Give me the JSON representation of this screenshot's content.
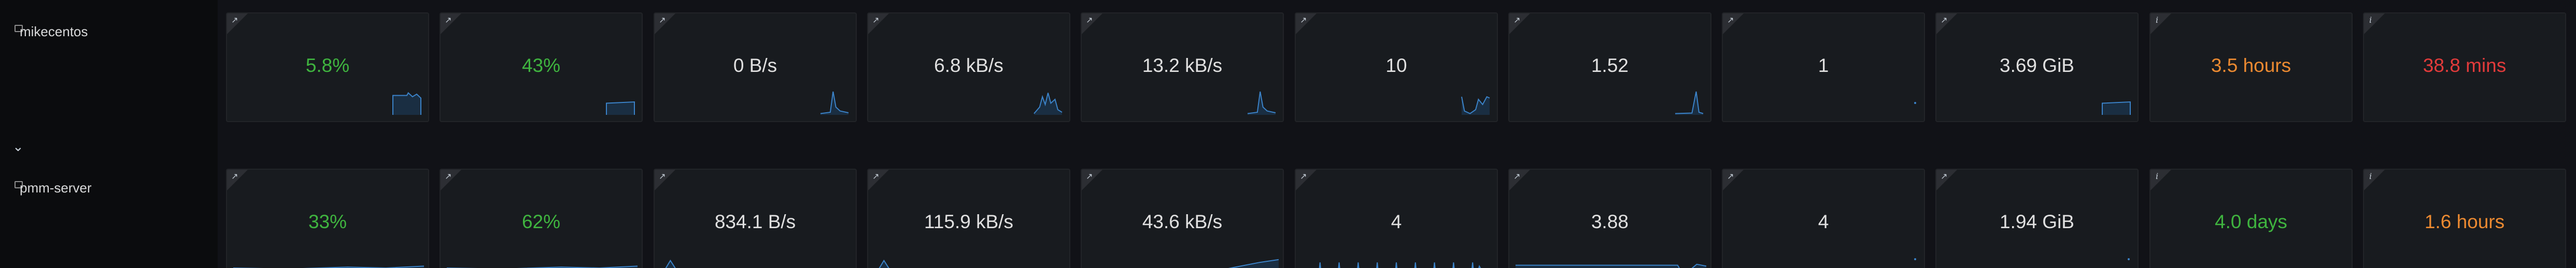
{
  "colors": {
    "green": "#3fb43f",
    "orange": "#ec8a31",
    "red": "#e23b3b",
    "neutral": "#e0e0e0",
    "spark_line": "#3b83c9",
    "spark_fill": "#1d3c5a"
  },
  "hosts": [
    {
      "name": "mikecentos",
      "stats": [
        {
          "value": "5.8%",
          "color": "green",
          "icon": "external-link-icon",
          "spark": "step-end"
        },
        {
          "value": "43%",
          "color": "green",
          "icon": "external-link-icon",
          "spark": "flat-end"
        },
        {
          "value": "0 B/s",
          "color": "neutral",
          "icon": "external-link-icon",
          "spark": "peak-end"
        },
        {
          "value": "6.8 kB/s",
          "color": "neutral",
          "icon": "external-link-icon",
          "spark": "multi-peak-end"
        },
        {
          "value": "13.2 kB/s",
          "color": "neutral",
          "icon": "external-link-icon",
          "spark": "peak-end"
        },
        {
          "value": "10",
          "color": "neutral",
          "icon": "external-link-icon",
          "spark": "wave-end"
        },
        {
          "value": "1.52",
          "color": "neutral",
          "icon": "external-link-icon",
          "spark": "spike-end"
        },
        {
          "value": "1",
          "color": "neutral",
          "icon": "external-link-icon",
          "spark": "dot"
        },
        {
          "value": "3.69 GiB",
          "color": "neutral",
          "icon": "external-link-icon",
          "spark": "flat-end"
        },
        {
          "value": "3.5 hours",
          "color": "orange",
          "icon": "info-icon",
          "spark": "none"
        },
        {
          "value": "38.8 mins",
          "color": "red",
          "icon": "info-icon",
          "spark": "none"
        }
      ]
    },
    {
      "name": "pmm-server",
      "stats": [
        {
          "value": "33%",
          "color": "green",
          "icon": "external-link-icon",
          "spark": "flat-full"
        },
        {
          "value": "62%",
          "color": "green",
          "icon": "external-link-icon",
          "spark": "flat-full"
        },
        {
          "value": "834.1 B/s",
          "color": "neutral",
          "icon": "external-link-icon",
          "spark": "spike-start"
        },
        {
          "value": "115.9 kB/s",
          "color": "neutral",
          "icon": "external-link-icon",
          "spark": "spike-start"
        },
        {
          "value": "43.6 kB/s",
          "color": "neutral",
          "icon": "external-link-icon",
          "spark": "ramp"
        },
        {
          "value": "4",
          "color": "neutral",
          "icon": "external-link-icon",
          "spark": "comb"
        },
        {
          "value": "3.88",
          "color": "neutral",
          "icon": "external-link-icon",
          "spark": "block"
        },
        {
          "value": "4",
          "color": "neutral",
          "icon": "external-link-icon",
          "spark": "dot"
        },
        {
          "value": "1.94 GiB",
          "color": "neutral",
          "icon": "external-link-icon",
          "spark": "dot"
        },
        {
          "value": "4.0 days",
          "color": "green",
          "icon": "info-icon",
          "spark": "none"
        },
        {
          "value": "1.6 hours",
          "color": "orange",
          "icon": "info-icon",
          "spark": "none"
        }
      ]
    }
  ]
}
